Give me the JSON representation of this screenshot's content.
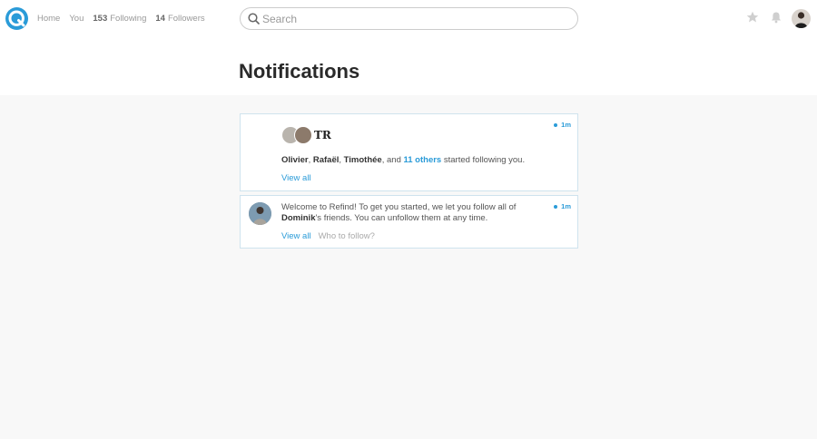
{
  "nav": {
    "home": "Home",
    "you": "You",
    "following_count": "153",
    "following_label": "Following",
    "followers_count": "14",
    "followers_label": "Followers"
  },
  "search": {
    "placeholder": "Search",
    "value": ""
  },
  "header_icons": [
    "star-icon",
    "bell-icon"
  ],
  "page_title": "Notifications",
  "notifications": [
    {
      "time": "1m",
      "avatars_initials": "TR",
      "names": [
        "Olivier",
        "Rafaël",
        "Timothée"
      ],
      "sep1": ", ",
      "sep2": ", ",
      "and": ", and ",
      "others": "11 others",
      "tail": " started following you.",
      "action": "View all"
    },
    {
      "time": "1m",
      "text_a": "Welcome to Refind! To get you started, we let you follow all of",
      "name": "Dominik",
      "text_b": "'s friends. You can unfollow them at any time.",
      "action": "View all",
      "action2": "Who to follow?"
    }
  ],
  "colors": {
    "accent": "#2a9bd8",
    "border": "#cfe3ee"
  }
}
